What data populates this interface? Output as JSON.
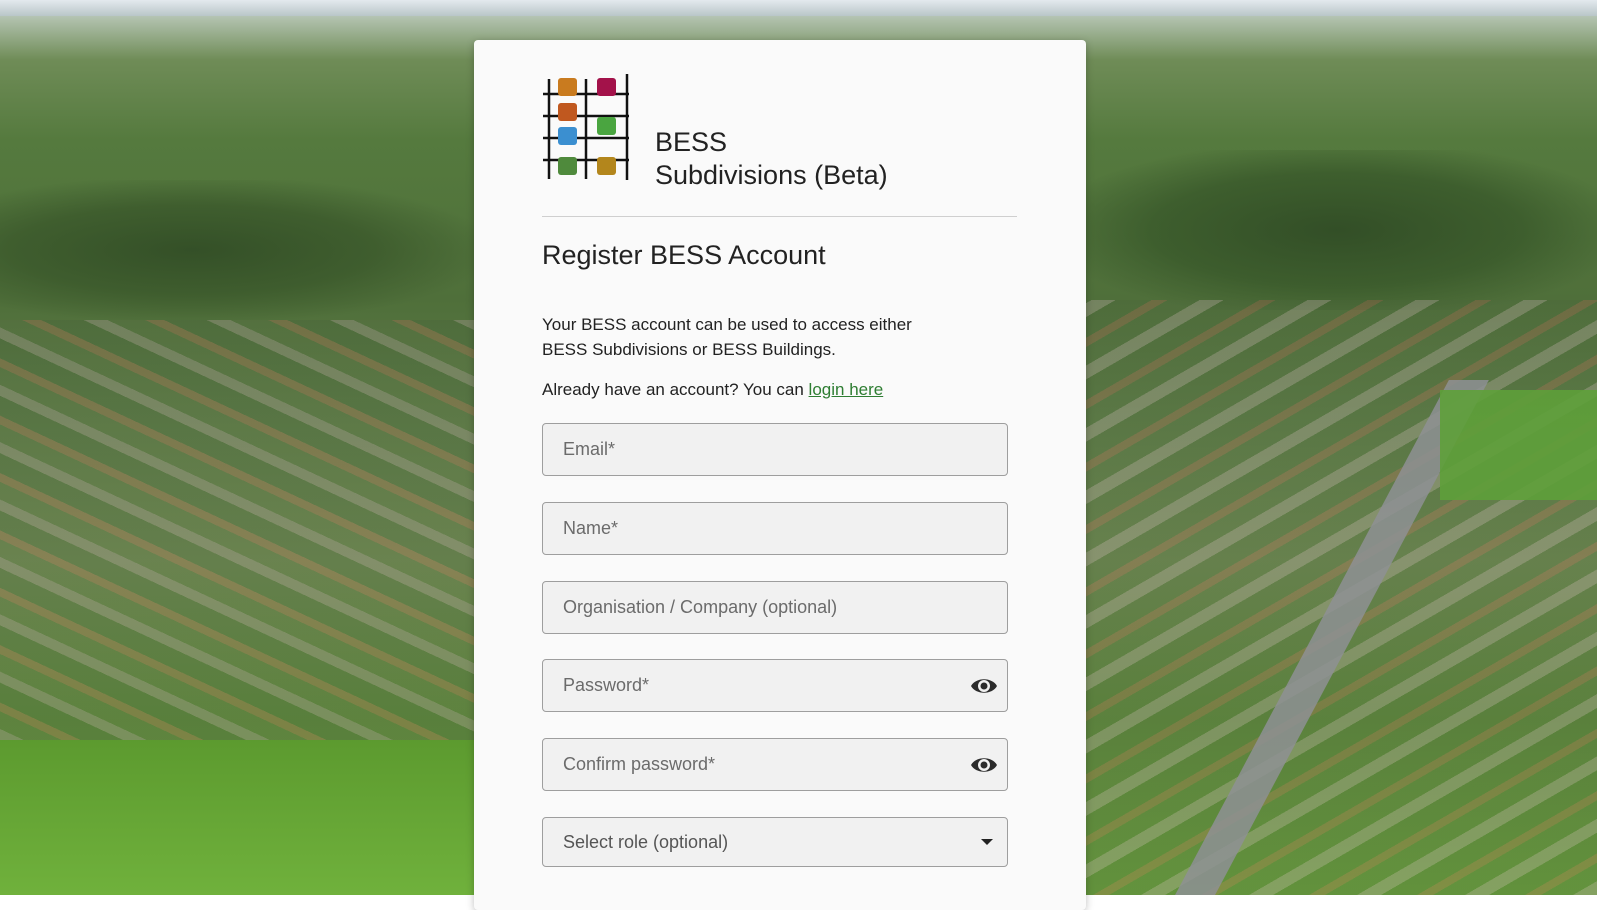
{
  "brand": {
    "line1": "BESS",
    "line2": "Subdivisions (Beta)",
    "logo_colors": [
      "#c97b1f",
      "#a3124a",
      "#c0581f",
      "#3b8fd0",
      "#4aa540",
      "#4f8a3c",
      "#b3861c"
    ]
  },
  "page": {
    "heading": "Register BESS Account",
    "intro": "Your BESS account can be used to access either BESS Subdivisions or BESS Buildings.",
    "login_prefix": "Already have an account? You can ",
    "login_link": "login here"
  },
  "form": {
    "email_placeholder": "Email*",
    "name_placeholder": "Name*",
    "organisation_placeholder": "Organisation / Company (optional)",
    "password_placeholder": "Password*",
    "confirm_password_placeholder": "Confirm password*",
    "role_placeholder": "Select role (optional)"
  },
  "icons": {
    "password_toggle": "eye-icon",
    "confirm_toggle": "eye-icon",
    "role_dropdown": "caret-down-icon"
  }
}
